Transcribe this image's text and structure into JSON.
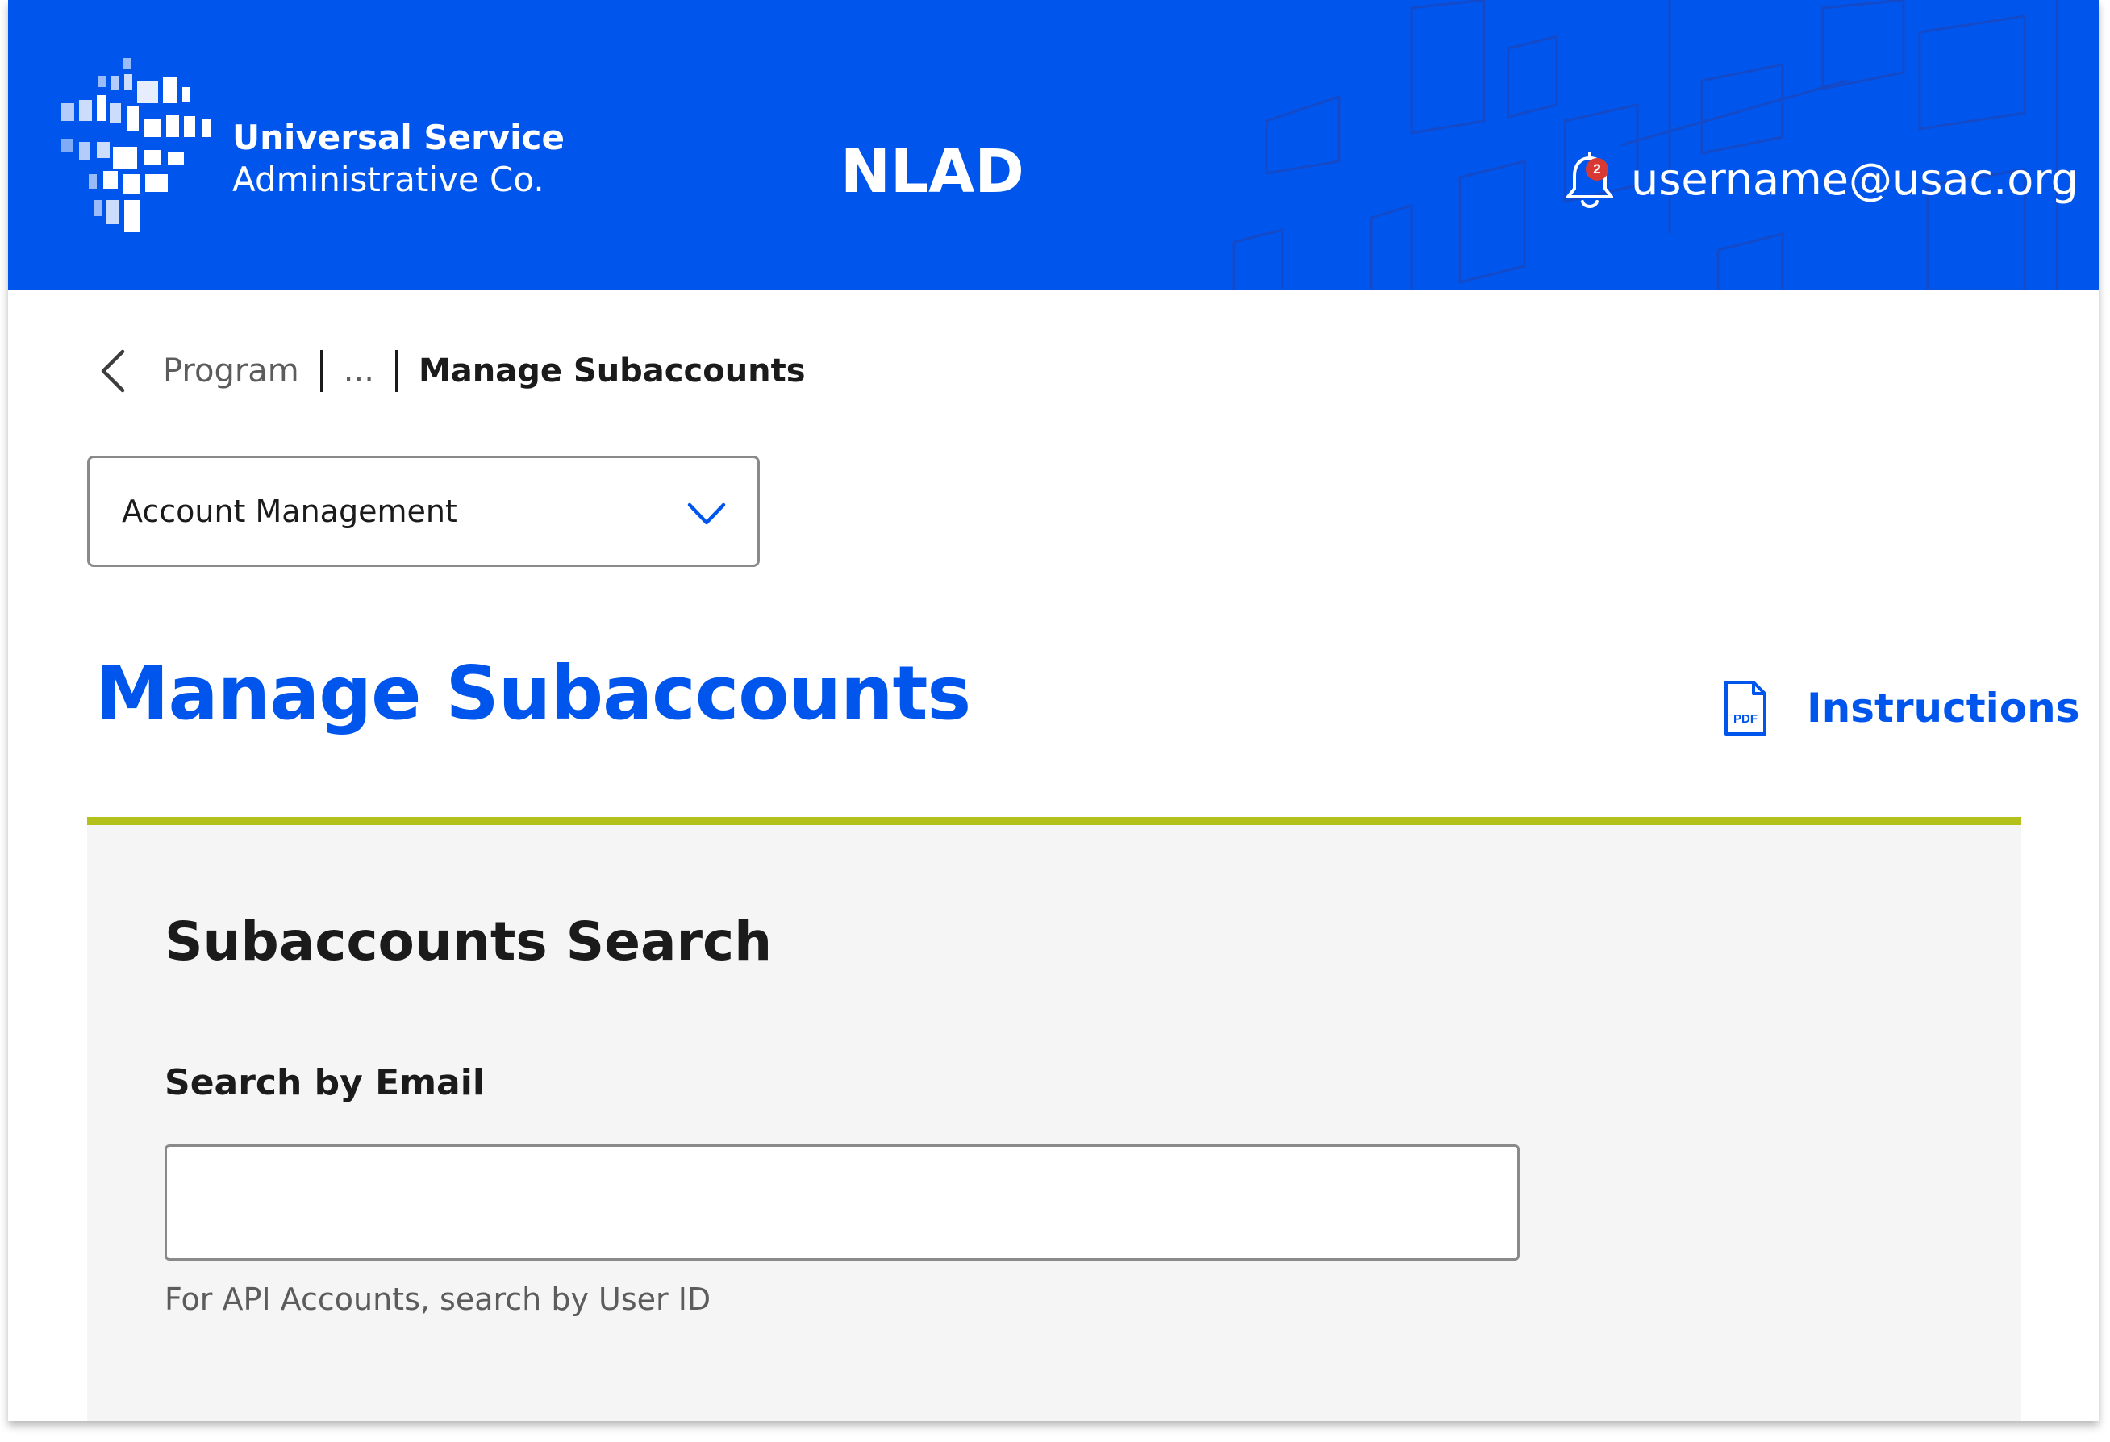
{
  "header": {
    "logo_line1": "Universal Service",
    "logo_line2": "Administrative Co.",
    "app_title": "NLAD",
    "notification_count": "2",
    "username": "username@usac.org",
    "background_color": "#0056ec"
  },
  "breadcrumb": {
    "items": [
      "Program",
      "...",
      "Manage Subaccounts"
    ]
  },
  "dropdown": {
    "selected": "Account Management"
  },
  "page": {
    "title": "Manage Subaccounts",
    "instructions_label": "Instructions",
    "title_color": "#0056ec"
  },
  "search_panel": {
    "title": "Subaccounts Search",
    "email_label": "Search by Email",
    "email_value": "",
    "email_hint": "For API Accounts, search by User ID",
    "accent_color": "#b4c11c"
  },
  "icons": {
    "logo": "usac-logo-icon",
    "bell": "bell-icon",
    "back": "chevron-left-icon",
    "dropdown": "chevron-down-icon",
    "pdf": "pdf-icon"
  }
}
